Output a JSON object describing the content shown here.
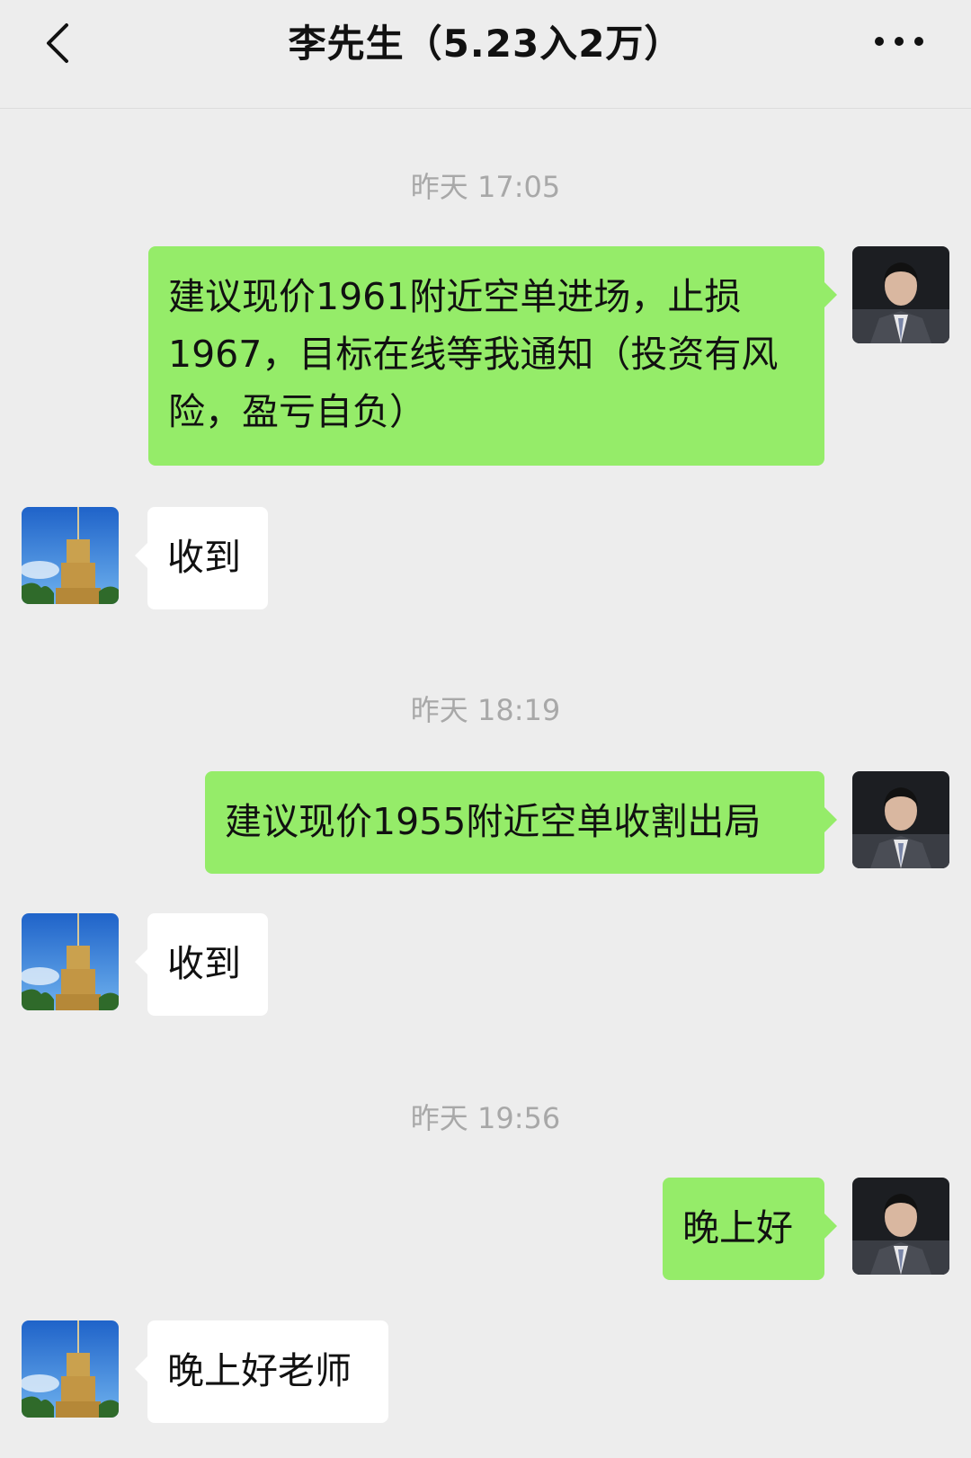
{
  "header": {
    "title": "李先生（5.23入2万）",
    "back_icon": "chevron-left-icon",
    "more_icon": "more-horizontal-icon"
  },
  "messages": [
    {
      "time": "昨天 17:05"
    },
    {
      "from": "me",
      "text": "建议现价1961附近空单进场，止损1967，目标在线等我通知（投资有风险，盈亏自负）"
    },
    {
      "from": "them",
      "text": "收到"
    },
    {
      "time": "昨天 18:19"
    },
    {
      "from": "me",
      "text": "建议现价1955附近空单收割出局"
    },
    {
      "from": "them",
      "text": "收到"
    },
    {
      "time": "昨天 19:56"
    },
    {
      "from": "me",
      "text": "晚上好"
    },
    {
      "from": "them",
      "text": "晚上好老师"
    }
  ],
  "colors": {
    "background": "#ededed",
    "my_bubble": "#95ec69",
    "their_bubble": "#ffffff",
    "timestamp": "#a8a8a8"
  }
}
